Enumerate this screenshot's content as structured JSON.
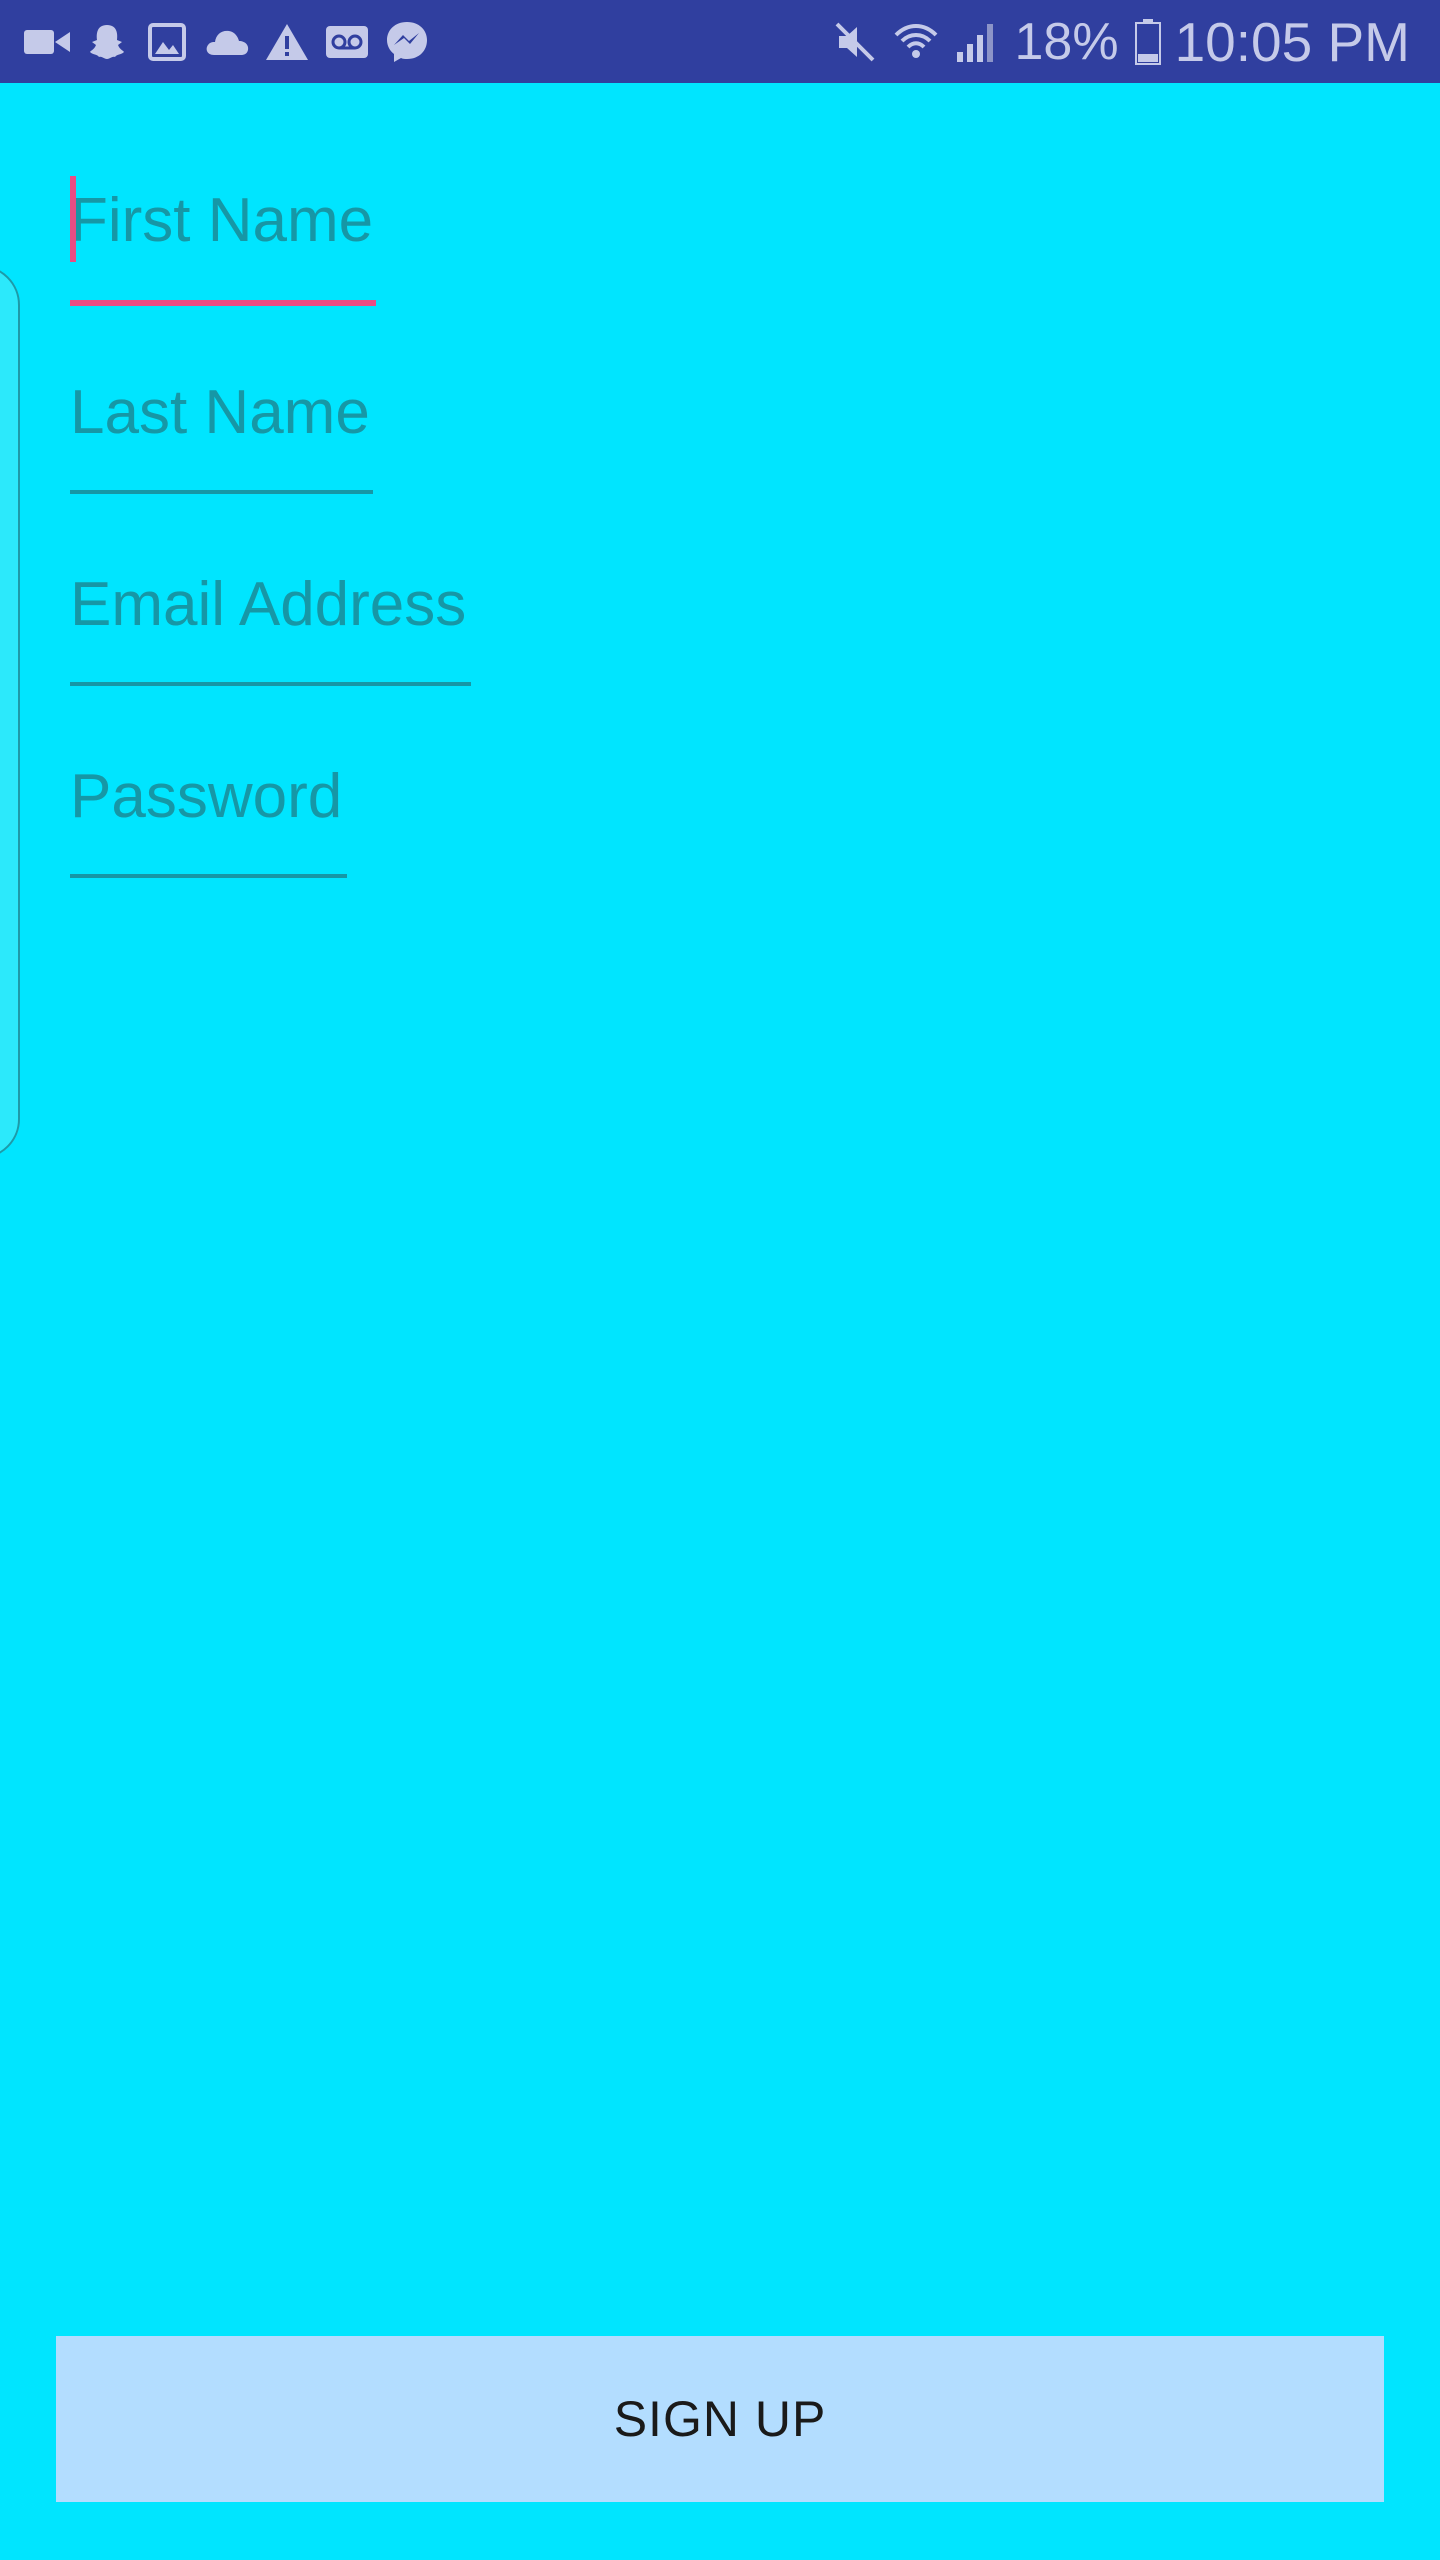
{
  "status_bar": {
    "notification_icons": [
      "video-camera-icon",
      "snapchat-ghost-icon",
      "gallery-image-icon",
      "cloud-icon",
      "warning-icon",
      "voicemail-icon",
      "messenger-icon"
    ],
    "system_icons": [
      "mute-icon",
      "wifi-icon",
      "cellular-signal-icon",
      "battery-icon"
    ],
    "battery_percent": "18%",
    "time": "10:05 PM",
    "background_color": "#303F9F"
  },
  "form": {
    "first_name_hint": "First Name",
    "last_name_hint": "Last Name",
    "email_hint": "Email Address",
    "password_hint": "Password",
    "focused_field": "first_name"
  },
  "actions": {
    "signup_label": "SIGN UP"
  },
  "colors": {
    "background": "#00E5FF",
    "accent": "#E94C83",
    "hint_text": "#1697A6",
    "button": "#B3DDFF"
  }
}
